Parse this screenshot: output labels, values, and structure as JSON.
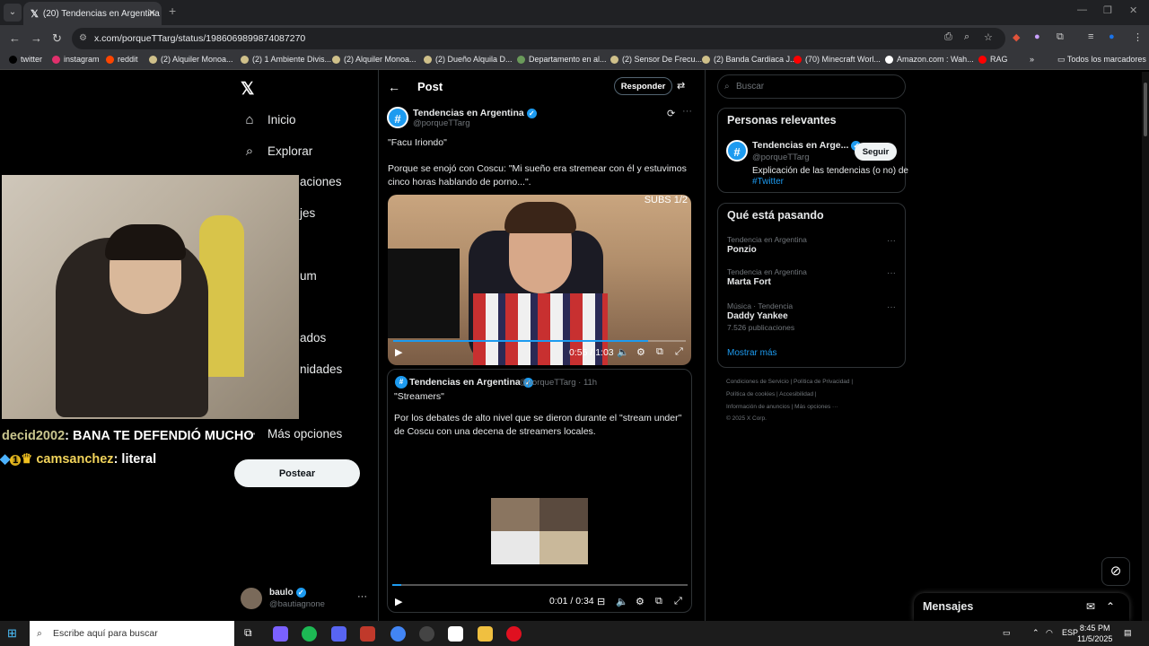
{
  "browser": {
    "tab_title": "(20) Tendencias en Argentina e",
    "url": "x.com/porqueTTarg/status/1986069899874087270",
    "bookmarks": [
      {
        "label": "twitter",
        "color": "#000000"
      },
      {
        "label": "instagram",
        "color": "#e1306c"
      },
      {
        "label": "reddit",
        "color": "#ff4500"
      },
      {
        "label": "(2) Alquiler Monoa...",
        "color": "#cfc08a"
      },
      {
        "label": "(2) 1 Ambiente Divis...",
        "color": "#cfc08a"
      },
      {
        "label": "(2) Alquiler Monoa...",
        "color": "#cfc08a"
      },
      {
        "label": "(2) Dueño Alquila D...",
        "color": "#cfc08a"
      },
      {
        "label": "Departamento en al...",
        "color": "#6a9a5a"
      },
      {
        "label": "(2) Sensor De Frecu...",
        "color": "#cfc08a"
      },
      {
        "label": "(2) Banda Cardiaca J...",
        "color": "#cfc08a"
      },
      {
        "label": "(70) Minecraft Worl...",
        "color": "#ff0000"
      },
      {
        "label": "Amazon.com : Wah...",
        "color": "#ffffff"
      },
      {
        "label": "RAG",
        "color": "#ff0000"
      }
    ],
    "all_bookmarks": "Todos los marcadores"
  },
  "nav": {
    "home": "Inicio",
    "explore": "Explorar",
    "notifications": "aciones",
    "messages": "jes",
    "premium": "um",
    "bookmarks": "ados",
    "communities": "nidades",
    "more": "Más opciones",
    "post": "Postear",
    "user_name": "baulo",
    "user_handle": "@bautiagnone"
  },
  "overlay": {
    "chat1_user": "decid2002",
    "chat1_msg": ": BANA TE DEFENDIÓ MUCHO",
    "chat2_user": "camsanchez",
    "chat2_msg": ": literal",
    "badge": "1"
  },
  "post": {
    "header": "Post",
    "reply": "Responder",
    "author": "Tendencias en Argentina",
    "handle": "@porqueTTarg",
    "quote_line": "\"Facu Iriondo\"",
    "text": "Porque se enojó con Coscu: \"Mi sueño era stremear con él y estuvimos cinco horas hablando de porno...\".",
    "video_subs": "SUBS 1/2",
    "video_time": "0:55 / 1:03",
    "video_progress": 0.87,
    "quoted_author": "Tendencias en Argentina",
    "quoted_meta": "@porqueTTarg · 11h",
    "quoted_title": "\"Streamers\"",
    "quoted_text": "Por los debates de alto nivel que se dieron durante el \"stream under\" de Coscu con una decena de streamers locales.",
    "video2_time": "0:01 / 0:34",
    "video2_progress": 0.03
  },
  "sidebar": {
    "search_placeholder": "Buscar",
    "relevant_title": "Personas relevantes",
    "rel_name": "Tendencias en Arge...",
    "rel_handle": "@porqueTTarg",
    "follow": "Seguir",
    "rel_bio": "Explicación de las tendencias (o no) de",
    "rel_link": "#Twitter",
    "happening_title": "Qué está pasando",
    "trends": [
      {
        "meta": "Tendencia en Argentina",
        "name": "Ponzio",
        "count": ""
      },
      {
        "meta": "Tendencia en Argentina",
        "name": "Marta Fort",
        "count": ""
      },
      {
        "meta": "Música · Tendencia",
        "name": "Daddy Yankee",
        "count": "7.526 publicaciones"
      }
    ],
    "show_more": "Mostrar más",
    "footer1": "Condiciones de Servicio  |  Política de Privacidad  |",
    "footer2": "Política de cookies  |  Accesibilidad  |",
    "footer3": "Información de anuncios  |  Más opciones ···",
    "footer4": "© 2025 X Corp.",
    "messages": "Mensajes"
  },
  "taskbar": {
    "search": "Escribe aquí para buscar",
    "lang": "ESP",
    "time": "8:45 PM",
    "date": "11/5/2025"
  }
}
